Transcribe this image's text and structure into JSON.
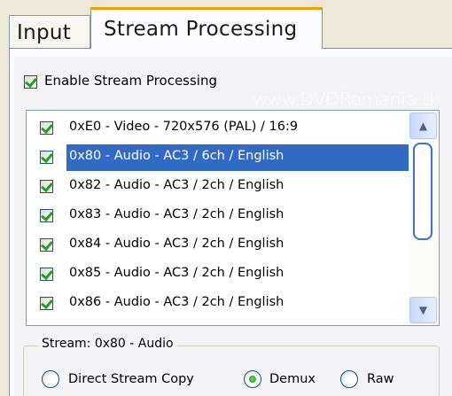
{
  "tabs": [
    {
      "label": "Input",
      "active": false
    },
    {
      "label": "Stream Processing",
      "active": true
    }
  ],
  "enable_checkbox": {
    "label": "Enable Stream Processing",
    "checked": true
  },
  "watermark": "www.DVDRomania.tk",
  "streams": [
    {
      "label": "0xE0 - Video - 720x576 (PAL) / 16:9",
      "checked": true,
      "selected": false
    },
    {
      "label": "0x80 - Audio - AC3 / 6ch / English",
      "checked": true,
      "selected": true
    },
    {
      "label": "0x82 - Audio - AC3 / 2ch / English",
      "checked": true,
      "selected": false
    },
    {
      "label": "0x83 - Audio - AC3 / 2ch / English",
      "checked": true,
      "selected": false
    },
    {
      "label": "0x84 - Audio - AC3 / 2ch / English",
      "checked": true,
      "selected": false
    },
    {
      "label": "0x85 - Audio - AC3 / 2ch / English",
      "checked": true,
      "selected": false
    },
    {
      "label": "0x86 - Audio - AC3 / 2ch / English",
      "checked": true,
      "selected": false
    }
  ],
  "scrollbar": {
    "up_icon": "▲",
    "down_icon": "▼"
  },
  "stream_group": {
    "title": "Stream: 0x80 - Audio",
    "options": [
      {
        "label": "Direct Stream Copy",
        "checked": false
      },
      {
        "label": "Demux",
        "checked": true
      },
      {
        "label": "Raw",
        "checked": false
      }
    ]
  },
  "colors": {
    "accent": "#316ac5",
    "tab_highlight": "#f0a000",
    "check": "#21a121"
  }
}
